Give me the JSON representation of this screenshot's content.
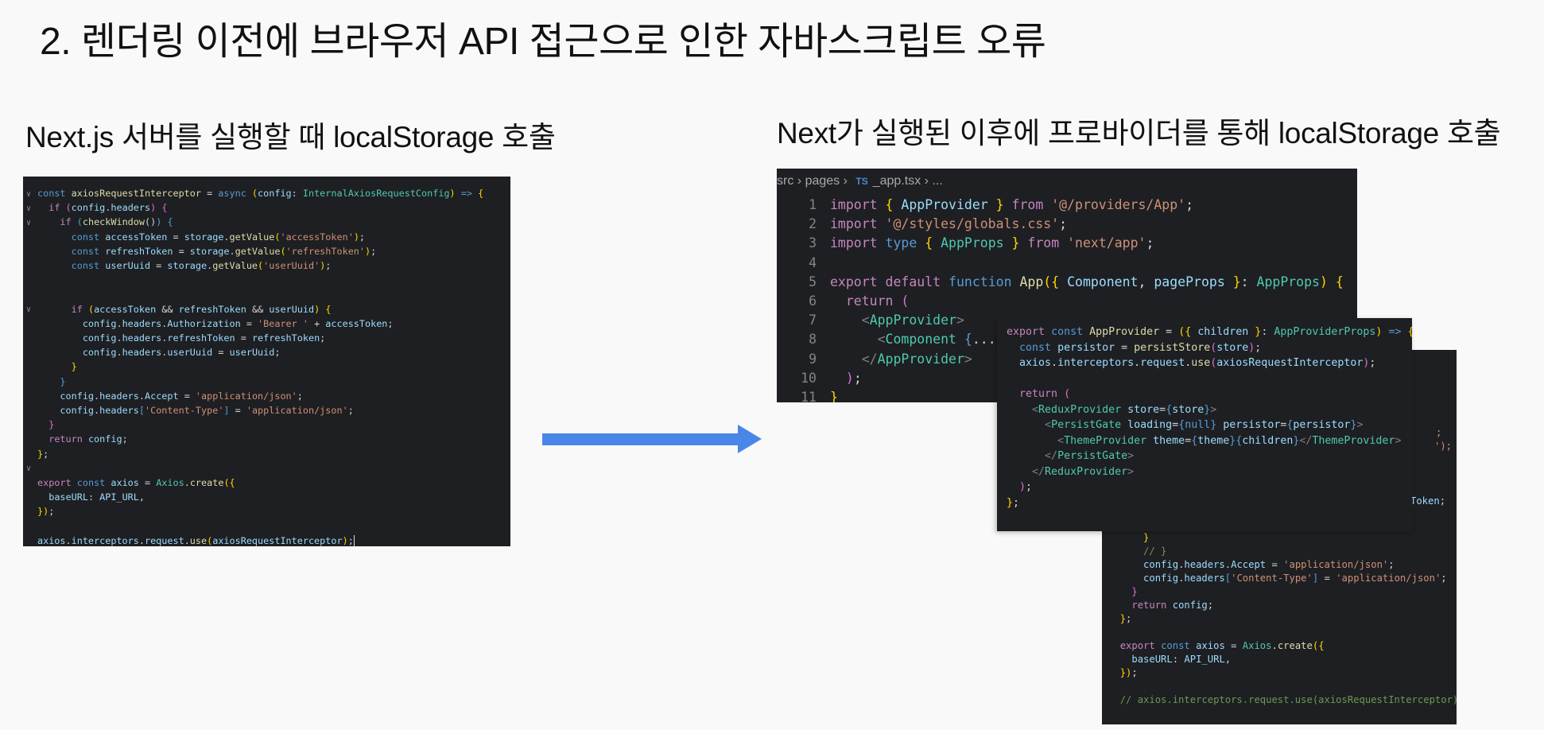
{
  "title": "2. 렌더링 이전에 브라우저 API 접근으로 인한 자바스크립트 오류",
  "left": {
    "subtitle": "Next.js 서버를 실행할 때 localStorage 호출"
  },
  "right": {
    "subtitle": "Next가 실행된 이후에 프로바이더를 통해 localStorage 호출",
    "breadcrumb": {
      "src": "src",
      "pages": "pages",
      "ts_badge": "TS",
      "file": "_app.tsx",
      "ellipsis": "..."
    },
    "line_numbers": [
      "1",
      "2",
      "3",
      "4",
      "5",
      "6",
      "7",
      "8",
      "9",
      "10",
      "11"
    ]
  },
  "arrow": {
    "color": "#4a86e8",
    "icon": "arrow-right-icon"
  }
}
